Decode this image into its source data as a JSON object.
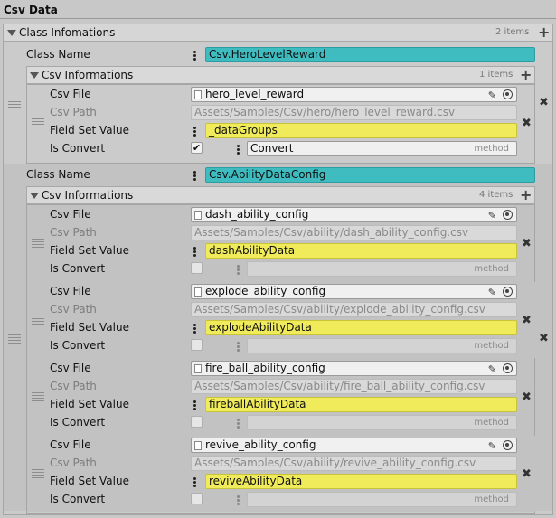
{
  "header": {
    "title": "Csv Data"
  },
  "class_list": {
    "label": "Class Infomations",
    "count": "2 items"
  },
  "icons": {
    "add": "plus-icon",
    "remove": "close-icon",
    "drag": "drag-handle-icon",
    "edit": "pencil-icon",
    "picker": "object-picker-icon",
    "file": "file-icon",
    "foldout": "triangle-down-icon"
  },
  "classes": [
    {
      "class_name_label": "Class Name",
      "class_name_value": "Csv.HeroLevelReward",
      "csv_list_label": "Csv Informations",
      "csv_list_count": "1 items",
      "items": [
        {
          "csv_file_label": "Csv File",
          "csv_file": "hero_level_reward",
          "csv_path_label": "Csv Path",
          "csv_path": "Assets/Samples/Csv/hero/hero_level_reward.csv",
          "field_label": "Field Set Value",
          "field_value": "_dataGroups",
          "convert_label": "Is Convert",
          "is_convert": true,
          "method_value": "Convert",
          "method_placeholder": "method"
        }
      ]
    },
    {
      "class_name_label": "Class Name",
      "class_name_value": "Csv.AbilityDataConfig",
      "csv_list_label": "Csv Informations",
      "csv_list_count": "4 items",
      "items": [
        {
          "csv_file_label": "Csv File",
          "csv_file": "dash_ability_config",
          "csv_path_label": "Csv Path",
          "csv_path": "Assets/Samples/Csv/ability/dash_ability_config.csv",
          "field_label": "Field Set Value",
          "field_value": "dashAbilityData",
          "convert_label": "Is Convert",
          "is_convert": false,
          "method_value": "",
          "method_placeholder": "method"
        },
        {
          "csv_file_label": "Csv File",
          "csv_file": "explode_ability_config",
          "csv_path_label": "Csv Path",
          "csv_path": "Assets/Samples/Csv/ability/explode_ability_config.csv",
          "field_label": "Field Set Value",
          "field_value": "explodeAbilityData",
          "convert_label": "Is Convert",
          "is_convert": false,
          "method_value": "",
          "method_placeholder": "method"
        },
        {
          "csv_file_label": "Csv File",
          "csv_file": "fire_ball_ability_config",
          "csv_path_label": "Csv Path",
          "csv_path": "Assets/Samples/Csv/ability/fire_ball_ability_config.csv",
          "field_label": "Field Set Value",
          "field_value": "fireballAbilityData",
          "convert_label": "Is Convert",
          "is_convert": false,
          "method_value": "",
          "method_placeholder": "method"
        },
        {
          "csv_file_label": "Csv File",
          "csv_file": "revive_ability_config",
          "csv_path_label": "Csv Path",
          "csv_path": "Assets/Samples/Csv/ability/revive_ability_config.csv",
          "field_label": "Field Set Value",
          "field_value": "reviveAbilityData",
          "convert_label": "Is Convert",
          "is_convert": false,
          "method_value": "",
          "method_placeholder": "method"
        }
      ]
    }
  ],
  "colors": {
    "class_field": "#3fbcc0",
    "value_field": "#f0eb5a",
    "panel": "#c8c8c8"
  }
}
